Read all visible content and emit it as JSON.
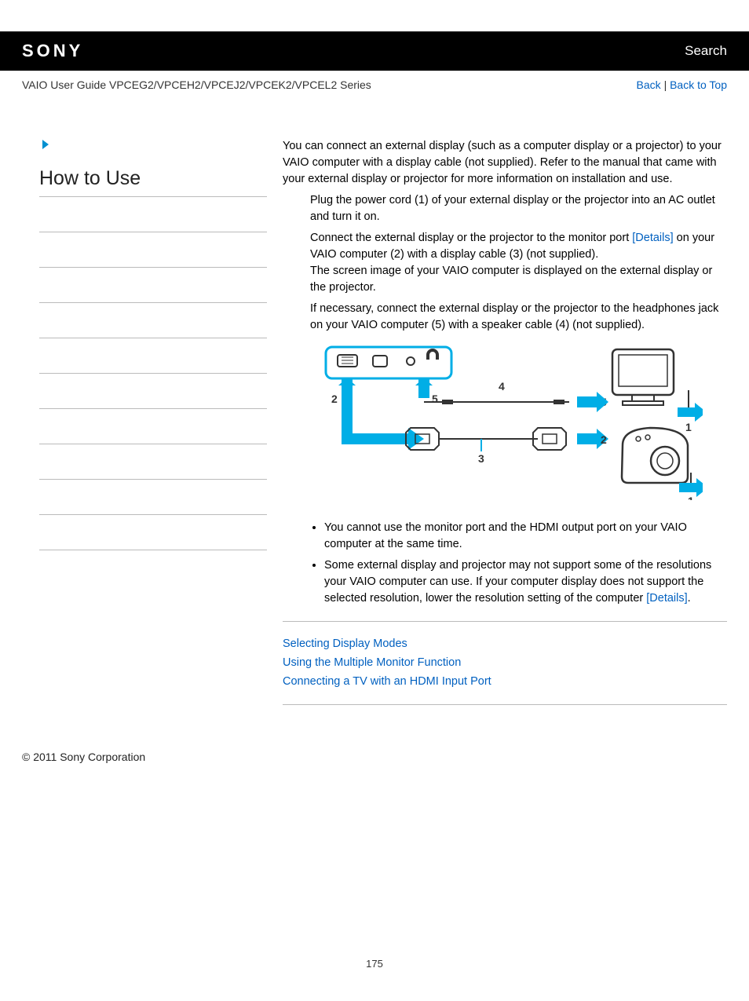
{
  "header": {
    "logo": "SONY",
    "search": "Search"
  },
  "subheader": {
    "guide_title": "VAIO User Guide VPCEG2/VPCEH2/VPCEJ2/VPCEK2/VPCEL2 Series",
    "back": "Back",
    "back_to_top": "Back to Top"
  },
  "sidebar": {
    "heading": "How to Use"
  },
  "main": {
    "intro": "You can connect an external display (such as a computer display or a projector) to your VAIO computer with a display cable (not supplied). Refer to the manual that came with your external display or projector for more information on installation and use.",
    "step1": "Plug the power cord (1) of your external display or the projector into an AC outlet and turn it on.",
    "step2a": "Connect the external display or the projector to the monitor port ",
    "step2_details": "[Details]",
    "step2b": " on your VAIO computer (2) with a display cable (3) (not supplied).",
    "step2_sub": "The screen image of your VAIO computer is displayed on the external display or the projector.",
    "step3": "If necessary, connect the external display or the projector to the headphones jack on your VAIO computer (5) with a speaker cable (4) (not supplied).",
    "note1": "You cannot use the monitor port and the HDMI output port on your VAIO computer at the same time.",
    "note2a": "Some external display and projector may not support some of the resolutions your VAIO computer can use. If your computer display does not support the selected resolution, lower the resolution setting of the computer ",
    "note2_details": "[Details]",
    "note2b": ".",
    "related1": "Selecting Display Modes",
    "related2": "Using the Multiple Monitor Function",
    "related3": "Connecting a TV with an HDMI Input Port"
  },
  "footer": {
    "copyright": "© 2011 Sony Corporation",
    "page_num": "175"
  },
  "diagram": {
    "labels": {
      "n1": "1",
      "n2": "2",
      "n3": "3",
      "n4": "4",
      "n5": "5"
    }
  }
}
